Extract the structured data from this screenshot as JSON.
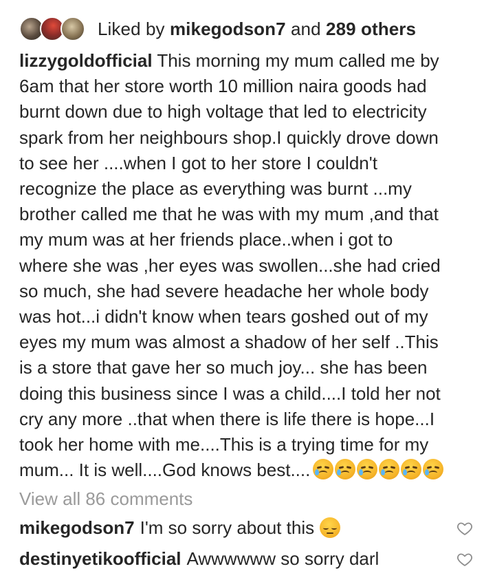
{
  "likes": {
    "prefix": "Liked by",
    "user": "mikegodson7",
    "connector": "and",
    "others": "289 others"
  },
  "caption": {
    "username": "lizzygoldofficial",
    "text": "This morning my mum called me by\n6am  that her store worth 10 million naira goods  had\nburnt down due to high voltage that led to electricity\nspark  from her neighbours shop.I quickly drove down\nto see her ....when I got  to her store I couldn't\nrecognize the place as everything was burnt ...my\nbrother called me that he was with my mum ,and that\nmy mum was at her friends place..when i got to\nwhere she was ,her eyes was swollen...she had cried\nso much, she had severe headache her whole body\nwas hot...i didn't know when tears goshed out of my\neyes my mum was almost a shadow of her self ..This\nis a store that gave her so much joy... she has been\ndoing this business since I was a child....I told her not\ncry any more ..that when there is life there is hope...I\ntook her home with me....This is a trying time for my\nmum... It is well....God knows best....",
    "emoji_icons": [
      "crying-face-icon",
      "crying-face-icon",
      "crying-face-icon",
      "crying-face-icon",
      "crying-face-icon",
      "crying-face-icon"
    ]
  },
  "comments_link": "View all 86 comments",
  "comments": [
    {
      "username": "mikegodson7",
      "text": "I'm so sorry about this",
      "emoji_icon": "pensive-face-icon"
    },
    {
      "username": "destinyetikoofficial",
      "text": "Awwwwww so sorry darl"
    }
  ],
  "colors": {
    "text": "#262626",
    "muted": "#9a9a9a",
    "background": "#ffffff"
  }
}
